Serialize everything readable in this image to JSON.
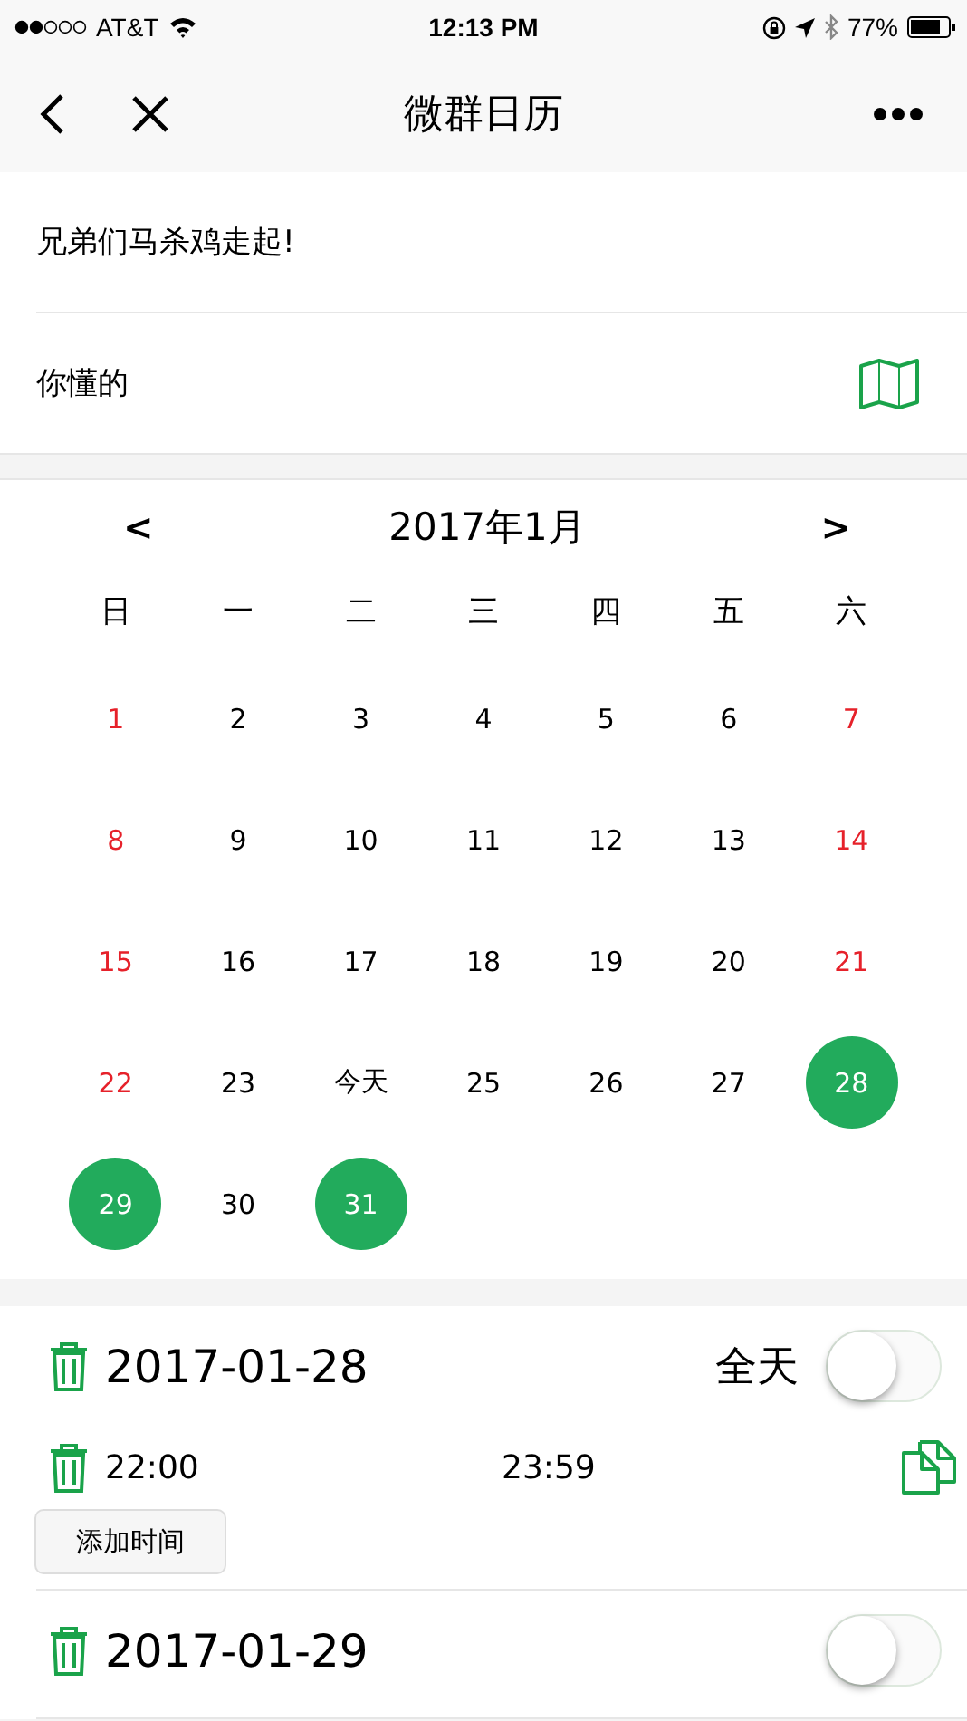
{
  "status_bar": {
    "carrier": "AT&T",
    "time": "12:13 PM",
    "battery": "77%"
  },
  "nav": {
    "title": "微群日历"
  },
  "event": {
    "title": "兄弟们马杀鸡走起!",
    "location": "你懂的"
  },
  "calendar": {
    "prev": "<",
    "month": "2017年1月",
    "next": ">",
    "weekdays": [
      "日",
      "一",
      "二",
      "三",
      "四",
      "五",
      "六"
    ],
    "days": [
      {
        "label": "1",
        "weekend": true,
        "selected": false
      },
      {
        "label": "2",
        "weekend": false,
        "selected": false
      },
      {
        "label": "3",
        "weekend": false,
        "selected": false
      },
      {
        "label": "4",
        "weekend": false,
        "selected": false
      },
      {
        "label": "5",
        "weekend": false,
        "selected": false
      },
      {
        "label": "6",
        "weekend": false,
        "selected": false
      },
      {
        "label": "7",
        "weekend": true,
        "selected": false
      },
      {
        "label": "8",
        "weekend": true,
        "selected": false
      },
      {
        "label": "9",
        "weekend": false,
        "selected": false
      },
      {
        "label": "10",
        "weekend": false,
        "selected": false
      },
      {
        "label": "11",
        "weekend": false,
        "selected": false
      },
      {
        "label": "12",
        "weekend": false,
        "selected": false
      },
      {
        "label": "13",
        "weekend": false,
        "selected": false
      },
      {
        "label": "14",
        "weekend": true,
        "selected": false
      },
      {
        "label": "15",
        "weekend": true,
        "selected": false
      },
      {
        "label": "16",
        "weekend": false,
        "selected": false
      },
      {
        "label": "17",
        "weekend": false,
        "selected": false
      },
      {
        "label": "18",
        "weekend": false,
        "selected": false
      },
      {
        "label": "19",
        "weekend": false,
        "selected": false
      },
      {
        "label": "20",
        "weekend": false,
        "selected": false
      },
      {
        "label": "21",
        "weekend": true,
        "selected": false
      },
      {
        "label": "22",
        "weekend": true,
        "selected": false
      },
      {
        "label": "23",
        "weekend": false,
        "selected": false
      },
      {
        "label": "今天",
        "weekend": false,
        "selected": false
      },
      {
        "label": "25",
        "weekend": false,
        "selected": false
      },
      {
        "label": "26",
        "weekend": false,
        "selected": false
      },
      {
        "label": "27",
        "weekend": false,
        "selected": false
      },
      {
        "label": "28",
        "selected": true
      },
      {
        "label": "29",
        "selected": true
      },
      {
        "label": "30",
        "weekend": false,
        "selected": false
      },
      {
        "label": "31",
        "selected": true
      }
    ]
  },
  "dates": [
    {
      "date": "2017-01-28",
      "all_day_label": "全天",
      "all_day": false,
      "times": [
        {
          "start": "22:00",
          "end": "23:59"
        }
      ],
      "add_time": "添加时间"
    },
    {
      "date": "2017-01-29",
      "all_day": false
    }
  ]
}
